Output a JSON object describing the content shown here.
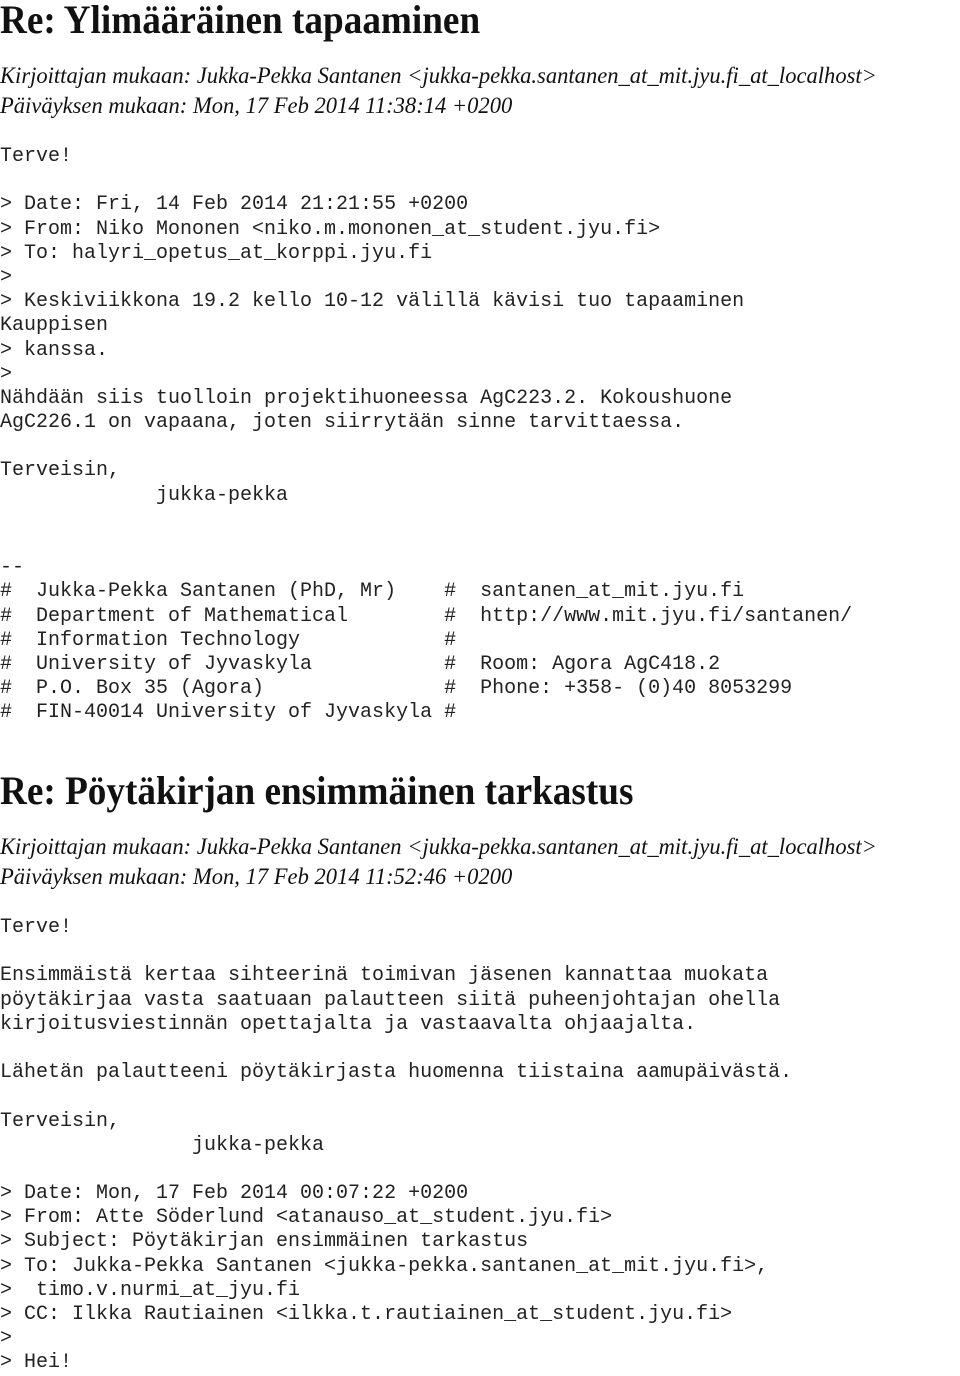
{
  "messages": [
    {
      "title": "Re: Ylimääräinen tapaaminen",
      "author_line": "Kirjoittajan mukaan: Jukka-Pekka Santanen <jukka-pekka.santanen_at_mit.jyu.fi_at_localhost>",
      "date_line": "Päiväyksen mukaan: Mon, 17 Feb 2014 11:38:14 +0200",
      "body_lines": [
        "Terve!",
        "",
        "> Date: Fri, 14 Feb 2014 21:21:55 +0200",
        "> From: Niko Mononen <niko.m.mononen_at_student.jyu.fi>",
        "> To: halyri_opetus_at_korppi.jyu.fi",
        ">",
        "> Keskiviikkona 19.2 kello 10-12 välillä kävisi tuo tapaaminen",
        "Kauppisen",
        "> kanssa.",
        ">",
        "Nähdään siis tuolloin projektihuoneessa AgC223.2. Kokoushuone",
        "AgC226.1 on vapaana, joten siirrytään sinne tarvittaessa.",
        "",
        "Terveisin,",
        "             jukka-pekka",
        "",
        "",
        "--",
        "#  Jukka-Pekka Santanen (PhD, Mr)    #  santanen_at_mit.jyu.fi",
        "#  Department of Mathematical        #  http://www.mit.jyu.fi/santanen/",
        "#  Information Technology            #",
        "#  University of Jyvaskyla           #  Room: Agora AgC418.2",
        "#  P.O. Box 35 (Agora)               #  Phone: +358- (0)40 8053299",
        "#  FIN-40014 University of Jyvaskyla #"
      ]
    },
    {
      "title": "Re: Pöytäkirjan ensimmäinen tarkastus",
      "author_line": "Kirjoittajan mukaan: Jukka-Pekka Santanen <jukka-pekka.santanen_at_mit.jyu.fi_at_localhost>",
      "date_line": "Päiväyksen mukaan: Mon, 17 Feb 2014 11:52:46 +0200",
      "body_lines": [
        "Terve!",
        "",
        "Ensimmäistä kertaa sihteerinä toimivan jäsenen kannattaa muokata",
        "pöytäkirjaa vasta saatuaan palautteen siitä puheenjohtajan ohella",
        "kirjoitusviestinnän opettajalta ja vastaavalta ohjaajalta.",
        "",
        "Lähetän palautteeni pöytäkirjasta huomenna tiistaina aamupäivästä.",
        "",
        "Terveisin,",
        "                jukka-pekka",
        "",
        "> Date: Mon, 17 Feb 2014 00:07:22 +0200",
        "> From: Atte Söderlund <atanauso_at_student.jyu.fi>",
        "> Subject: Pöytäkirjan ensimmäinen tarkastus",
        "> To: Jukka-Pekka Santanen <jukka-pekka.santanen_at_mit.jyu.fi>,",
        ">  timo.v.nurmi_at_jyu.fi",
        "> CC: Ilkka Rautiainen <ilkka.t.rautiainen_at_student.jyu.fi>",
        ">",
        "> Hei!"
      ]
    }
  ]
}
